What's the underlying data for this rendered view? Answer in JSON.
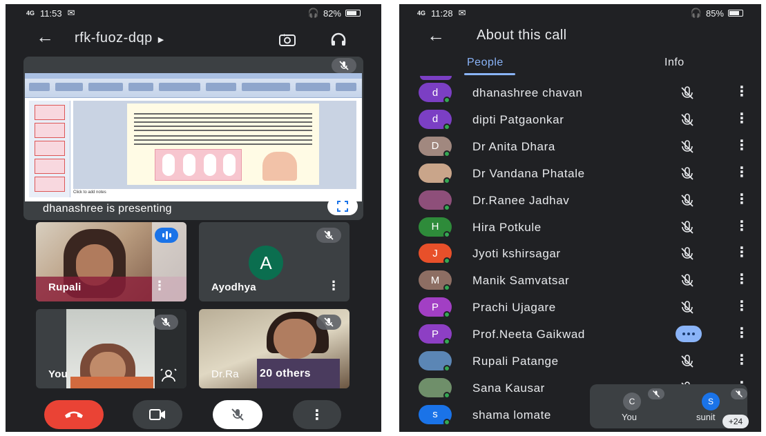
{
  "left_phone": {
    "status": {
      "signal": "4G",
      "time": "11:53",
      "battery": "82%",
      "battery_level": 0.82
    },
    "meeting_code": "rfk-fuoz-dqp",
    "presentation": {
      "label": "dhanashree is presenting",
      "notes_placeholder": "Click to add notes"
    },
    "tiles": [
      {
        "name": "Rupali"
      },
      {
        "name": "Ayodhya",
        "initial": "A"
      },
      {
        "name": "You"
      },
      {
        "name": "Dr.Ra",
        "others": "20 others"
      }
    ]
  },
  "right_phone": {
    "status": {
      "signal": "4G",
      "time": "11:28",
      "battery": "85%",
      "battery_level": 0.85
    },
    "title": "About this call",
    "tabs": [
      {
        "label": "People"
      },
      {
        "label": "Info"
      }
    ],
    "people": [
      {
        "name": "dhanashree chavan",
        "initial": "d",
        "color": "#7b3fc4"
      },
      {
        "name": "dipti Patgaonkar",
        "initial": "d",
        "color": "#7b3fc4"
      },
      {
        "name": "Dr Anita Dhara",
        "initial": "D",
        "color": "#a1887f"
      },
      {
        "name": "Dr Vandana Phatale",
        "initial": "",
        "color": "#c9a58a"
      },
      {
        "name": "Dr.Ranee Jadhav",
        "initial": "",
        "color": "#8e4f7a"
      },
      {
        "name": "Hira Potkule",
        "initial": "H",
        "color": "#2e8b3a"
      },
      {
        "name": "Jyoti kshirsagar",
        "initial": "J",
        "color": "#e8502a"
      },
      {
        "name": "Manik Samvatsar",
        "initial": "M",
        "color": "#8d6e63"
      },
      {
        "name": "Prachi Ujagare",
        "initial": "P",
        "color": "#a23fc4"
      },
      {
        "name": "Prof.Neeta Gaikwad",
        "initial": "P",
        "color": "#8d3fc4",
        "speaking": true
      },
      {
        "name": "Rupali Patange",
        "initial": "",
        "color": "#5b86b5"
      },
      {
        "name": "Sana Kausar",
        "initial": "",
        "color": "#6f8f6a"
      },
      {
        "name": "shama lomate",
        "initial": "s",
        "color": "#1a73e8"
      }
    ],
    "pip": {
      "you": {
        "initial": "C",
        "label": "You"
      },
      "other": {
        "initial": "S",
        "label": "sunit"
      },
      "more": "+24"
    }
  }
}
